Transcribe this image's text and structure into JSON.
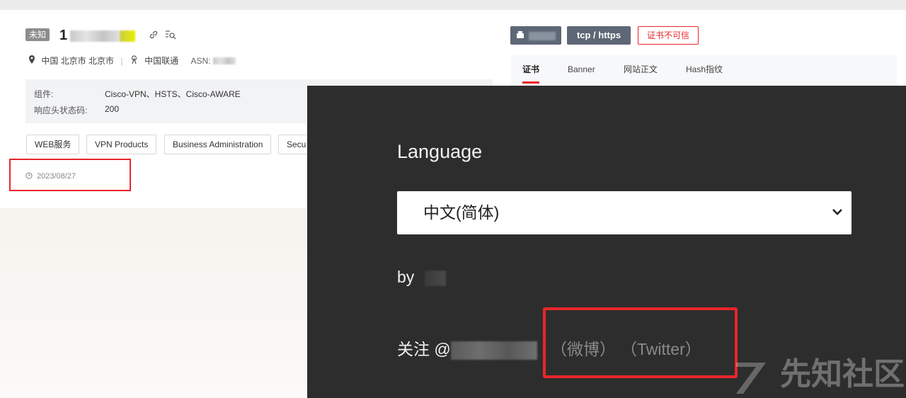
{
  "asset": {
    "status_tag": "未知",
    "ip_prefix": "1",
    "location": "中国 北京市 北京市",
    "isp": "中国联通",
    "asn_label": "ASN:"
  },
  "details": {
    "component_label": "组件:",
    "component_value": "Cisco-VPN、HSTS、Cisco-AWARE",
    "status_label": "响应头状态码:",
    "status_value": "200"
  },
  "chips": [
    "WEB服务",
    "VPN Products",
    "Business Administration",
    "Secu"
  ],
  "date": "2023/08/27",
  "right_panel": {
    "protocol_button": "tcp / https",
    "cert_badge": "证书不可信",
    "tabs": [
      "证书",
      "Banner",
      "网站正文",
      "Hash指纹"
    ]
  },
  "overlay": {
    "language_label": "Language",
    "language_value": "中文(简体)",
    "by_label": "by",
    "follow_label": "关注 @",
    "weibo_link": "（微博）",
    "twitter_link": "（Twitter）"
  },
  "watermark": "先知社区",
  "colors": {
    "accent_red": "#e8262b",
    "dark_panel": "#2d2d2d",
    "button_gray": "#5e6776"
  }
}
